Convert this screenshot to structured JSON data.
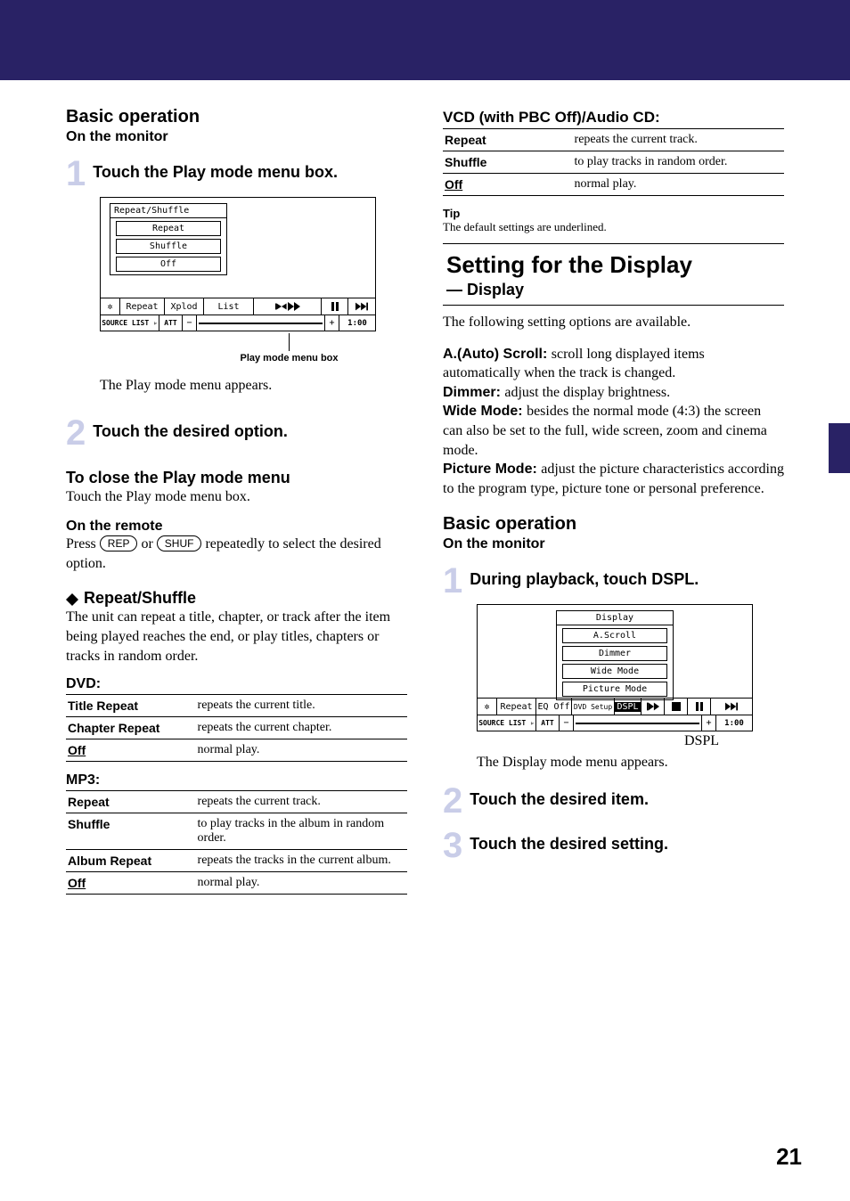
{
  "left": {
    "basic_op": "Basic operation",
    "on_monitor": "On the monitor",
    "step1": "Touch the Play mode menu box.",
    "step2": "Touch the desired option.",
    "callout1": "Play mode menu box",
    "after_fig": "The Play mode menu appears.",
    "close_h": "To close the Play mode menu",
    "close_body": "Touch the Play mode menu box.",
    "remote_h": "On the remote",
    "remote_pre": "Press ",
    "rep": "REP",
    "or": " or ",
    "shuf": "SHUF",
    "remote_post": " repeatedly to select the desired option.",
    "rs_h": "Repeat/Shuffle",
    "rs_body": "The unit can repeat a title, chapter, or track after the item being played reaches the end, or play titles, chapters or tracks in random order.",
    "dvd_h": "DVD:",
    "dvd_rows": [
      {
        "k": "Title Repeat",
        "v": "repeats the current title.",
        "u": false
      },
      {
        "k": "Chapter Repeat",
        "v": "repeats the current chapter.",
        "u": false
      },
      {
        "k": "Off",
        "v": "normal play.",
        "u": true
      }
    ],
    "mp3_h": "MP3:",
    "mp3_rows": [
      {
        "k": "Repeat",
        "v": "repeats the current track.",
        "u": false
      },
      {
        "k": "Shuffle",
        "v": "to play tracks in the album in random order.",
        "u": false
      },
      {
        "k": "Album Repeat",
        "v": "repeats the tracks in the current album.",
        "u": false
      },
      {
        "k": "Off",
        "v": "normal play.",
        "u": true
      }
    ],
    "monitor": {
      "dd_head": "Repeat/Shuffle",
      "dd1": "Repeat",
      "dd2": "Shuffle",
      "dd3": "Off",
      "r1a": "Repeat",
      "r1b": "Xplod",
      "r1c": "List",
      "src": "SOURCE LIST ▹",
      "att": "ATT",
      "time": "1:00"
    }
  },
  "right": {
    "vcd_h": "VCD (with PBC Off)/Audio CD:",
    "vcd_rows": [
      {
        "k": "Repeat",
        "v": "repeats the current track.",
        "u": false
      },
      {
        "k": "Shuffle",
        "v": "to play tracks in random order.",
        "u": false
      },
      {
        "k": "Off",
        "v": "normal play.",
        "u": true
      }
    ],
    "tip_h": "Tip",
    "tip_body": "The default settings are underlined.",
    "box_t1": "Setting for the Display",
    "box_t2": "— Display",
    "avail": "The following setting options are available.",
    "scroll_k": "A.(Auto) Scroll: ",
    "scroll_v": "scroll long displayed items automatically when the track is changed.",
    "dimmer_k": "Dimmer: ",
    "dimmer_v": "adjust the display brightness.",
    "wide_k": "Wide Mode: ",
    "wide_v": "besides the normal mode (4:3) the screen can also be set to the full, wide screen, zoom and cinema mode.",
    "pic_k": "Picture Mode: ",
    "pic_v": "adjust the picture characteristics according to the program type, picture tone or personal preference.",
    "basic_op": "Basic operation",
    "on_monitor": "On the monitor",
    "step1": "During playback, touch DSPL.",
    "callout": "DSPL",
    "after_fig": "The Display mode menu appears.",
    "step2": "Touch the desired item.",
    "step3": "Touch the desired setting.",
    "monitor": {
      "dd_head": "Display",
      "dd1": "A.Scroll",
      "dd2": "Dimmer",
      "dd3": "Wide Mode",
      "dd4": "Picture Mode",
      "r1a": "Repeat",
      "r1b": "EQ Off",
      "r1c": "DVD Setup",
      "r1d": "DSPL",
      "src": "SOURCE LIST ▹",
      "att": "ATT",
      "time": "1:00"
    }
  },
  "pagenum": "21"
}
